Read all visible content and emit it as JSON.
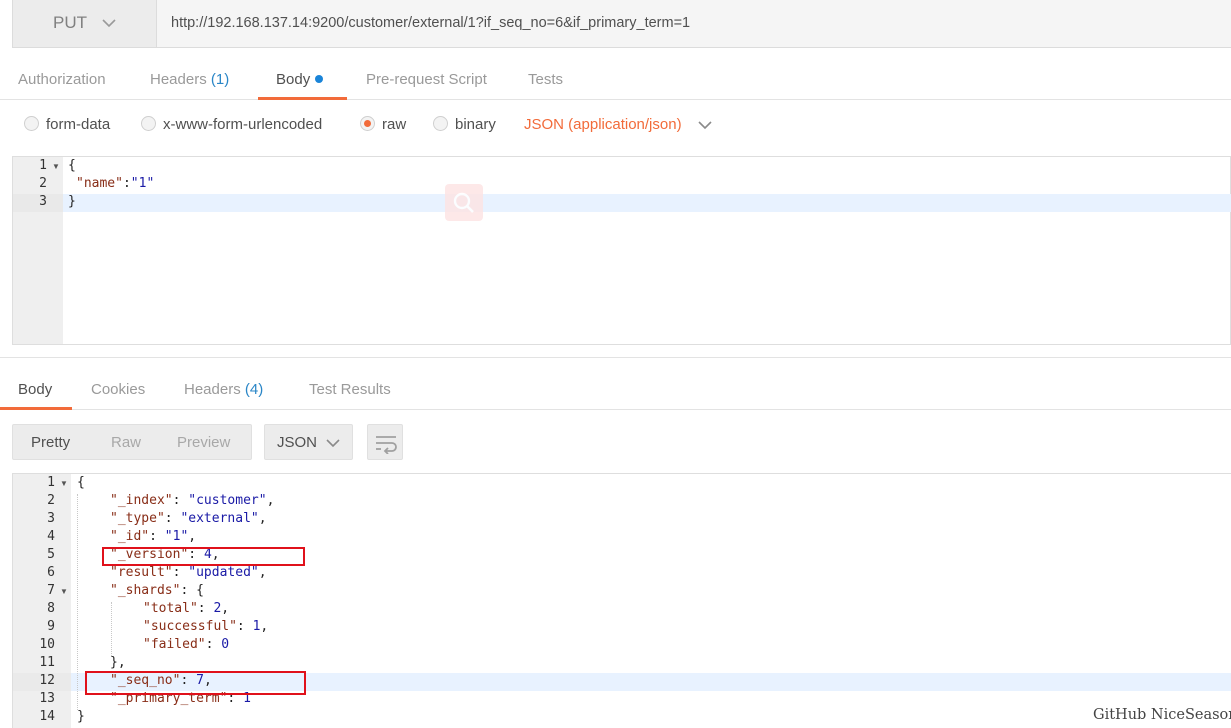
{
  "request": {
    "method": "PUT",
    "url": "http://192.168.137.14:9200/customer/external/1?if_seq_no=6&if_primary_term=1"
  },
  "request_tabs": [
    {
      "label": "Authorization",
      "count": ""
    },
    {
      "label": "Headers",
      "count": "(1)"
    },
    {
      "label": "Body",
      "count": ""
    },
    {
      "label": "Pre-request Script",
      "count": ""
    },
    {
      "label": "Tests",
      "count": ""
    }
  ],
  "active_request_tab": "Body",
  "body_types": [
    "form-data",
    "x-www-form-urlencoded",
    "raw",
    "binary"
  ],
  "selected_body_type": "raw",
  "content_type": "JSON (application/json)",
  "request_body": {
    "line_numbers": [
      "1",
      "2",
      "3"
    ],
    "lines": [
      "{",
      "\"name\":\"1\"",
      "}"
    ]
  },
  "response_tabs": [
    {
      "label": "Body",
      "count": ""
    },
    {
      "label": "Cookies",
      "count": ""
    },
    {
      "label": "Headers",
      "count": "(4)"
    },
    {
      "label": "Test Results",
      "count": ""
    }
  ],
  "active_response_tab": "Body",
  "view_modes": [
    "Pretty",
    "Raw",
    "Preview"
  ],
  "active_view_mode": "Pretty",
  "response_format": "JSON",
  "response_body": {
    "line_numbers": [
      "1",
      "2",
      "3",
      "4",
      "5",
      "6",
      "7",
      "8",
      "9",
      "10",
      "11",
      "12",
      "13",
      "14"
    ],
    "lines": [
      "{",
      "\"_index\": \"customer\",",
      "\"_type\": \"external\",",
      "\"_id\": \"1\",",
      "\"_version\": 4,",
      "\"result\": \"updated\",",
      "\"_shards\": {",
      "\"total\": 2,",
      "\"successful\": 1,",
      "\"failed\": 0",
      "},",
      "\"_seq_no\": 7,",
      "\"_primary_term\": 1",
      "}"
    ]
  },
  "highlighted_fields": [
    "_version",
    "_seq_no"
  ],
  "watermark": "GitHub NiceSeason",
  "colors": {
    "accent": "#f26b3a",
    "link_blue": "#2a86c7",
    "highlight_red": "#e0111b",
    "json_key": "#882d17",
    "json_value": "#1a1aa6"
  },
  "icons": [
    "chevron-down-icon",
    "wrap-lines-icon",
    "search-icon",
    "fold-arrow-icon"
  ]
}
